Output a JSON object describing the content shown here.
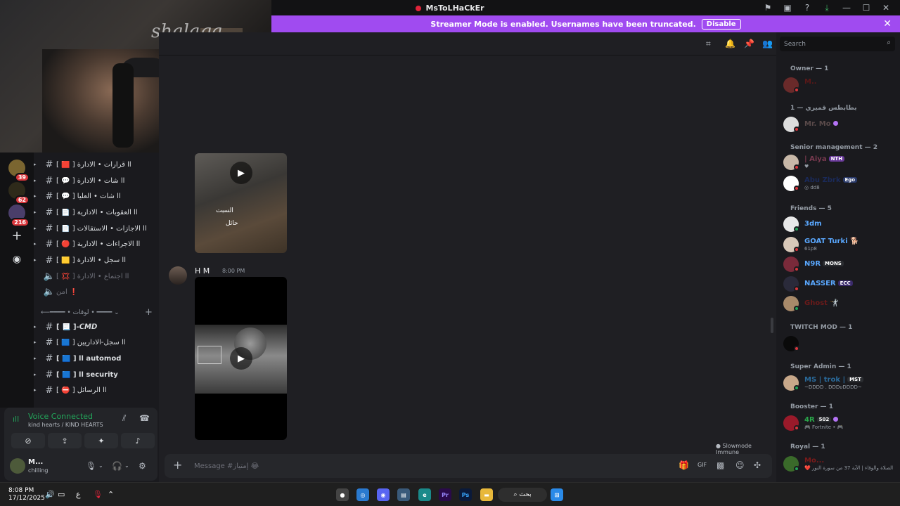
{
  "window": {
    "title": "MsToLHaCkEr"
  },
  "banner": {
    "message": "Streamer Mode is enabled. Usernames have been truncated.",
    "button": "Disable"
  },
  "webcam": {
    "signature": "shalaga"
  },
  "servers": [
    {
      "badge": "39"
    },
    {
      "badge": "62"
    },
    {
      "badge": "216"
    }
  ],
  "channels": [
    {
      "label": "[ 🟥 ] اا قرارات • الادارة",
      "muted": false
    },
    {
      "label": "[ 💬 ] اا شات • الادارة",
      "muted": false
    },
    {
      "label": "[ 💬 ] اا شات • العليا",
      "muted": false
    },
    {
      "label": "[ 📄 ] اا العقوبات • الادارية",
      "muted": false
    },
    {
      "label": "[ 📄 ] اا الاجازات • الاستقالات",
      "muted": false
    },
    {
      "label": "[ 🔴 ] اا الاجراءات • الادارية",
      "muted": false
    },
    {
      "label": "[ 🟨 ] اا سجل • الادارة",
      "muted": false
    },
    {
      "label": "[ 💢 ] اا اجتماع • الادارة",
      "muted": true
    },
    {
      "label": "امن ❗",
      "muted": true
    }
  ],
  "category": {
    "label": "⟵━━━━ • لوقات • ━━━━ ⌄"
  },
  "channels2": [
    {
      "label": "[ 📃 ]-𝘾𝙈𝘿"
    },
    {
      "label": "[ 🟦 ] اا سجل-الاداريين"
    },
    {
      "label": "[ 🟦 ] اا automod"
    },
    {
      "label": "[ 🟦 ] اا security"
    },
    {
      "label": "[ ⛔ ] اا الرسائل"
    }
  ],
  "voice": {
    "status": "Voice Connected",
    "sub": "kind hearts / KIND HEARTS"
  },
  "user": {
    "name": "M...",
    "status": "chilling"
  },
  "chat": {
    "video1_text_top": "السبت",
    "video1_text_bottom": "حائل",
    "author": "H M",
    "time": "8:00 PM",
    "slowmode": "Slowmode Immune",
    "composer_placeholder": "Message #إمتياز 😂"
  },
  "search": {
    "placeholder": "Search"
  },
  "member_groups": [
    {
      "label": "Owner — 1"
    },
    {
      "label": "بطابطس قميري — 1"
    },
    {
      "label": "Senior management — 2"
    },
    {
      "label": "Friends — 5"
    },
    {
      "label": "TWITCH MOD — 1"
    },
    {
      "label": "Super Admin — 1"
    },
    {
      "label": "Booster — 1"
    },
    {
      "label": "Royal — 1"
    }
  ],
  "members": {
    "owner": {
      "name": "M.."
    },
    "b1": {
      "name": "Mr. Mo"
    },
    "s1": {
      "name": "| Aiya",
      "tag": "NTH"
    },
    "s2": {
      "name": "Abu Zbrk",
      "tag": "Ego",
      "sub": "dd8"
    },
    "f1": {
      "name": "3dm"
    },
    "f2": {
      "name": "GOAT Turki 🐕",
      "sub": "61p8"
    },
    "f3": {
      "name": "N9R",
      "tag": "MONS"
    },
    "f4": {
      "name": "NASSER",
      "tag": "ECC"
    },
    "f5": {
      "name": "Ghost 🤺"
    },
    "t1": {
      "name": ""
    },
    "sa1": {
      "name": "MS | trok |",
      "tag": "MST",
      "sub": "~DDDD . DDDυDDDD~"
    },
    "bo1": {
      "name": "4R",
      "tag": "502",
      "sub": "🎮 Fortnite • 🎮"
    },
    "r1": {
      "name": "Mo...",
      "sub": "❤️ الصلاة والوقاء | الآية 37 من سورة النور"
    }
  },
  "taskbar": {
    "time": "8:08 PM",
    "date": "17/12/2025",
    "lang": "ع",
    "search": "بحث"
  }
}
